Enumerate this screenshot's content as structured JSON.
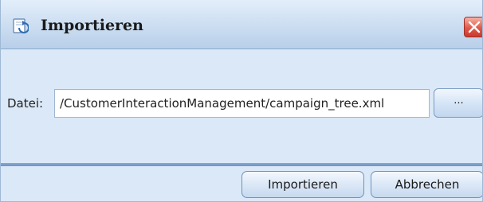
{
  "dialog": {
    "title": "Importieren",
    "close_icon": "close-icon",
    "title_icon": "import-icon"
  },
  "form": {
    "file_label": "Datei:",
    "file_value": "/CustomerInteractionManagement/campaign_tree.xml",
    "browse_label": "..."
  },
  "footer": {
    "import_label": "Importieren",
    "cancel_label": "Abbrechen"
  },
  "colors": {
    "title_bg": "#cfe0f3",
    "body_bg": "#dbe8f7",
    "close_red": "#e0584a",
    "separator": "#6f93c2"
  }
}
